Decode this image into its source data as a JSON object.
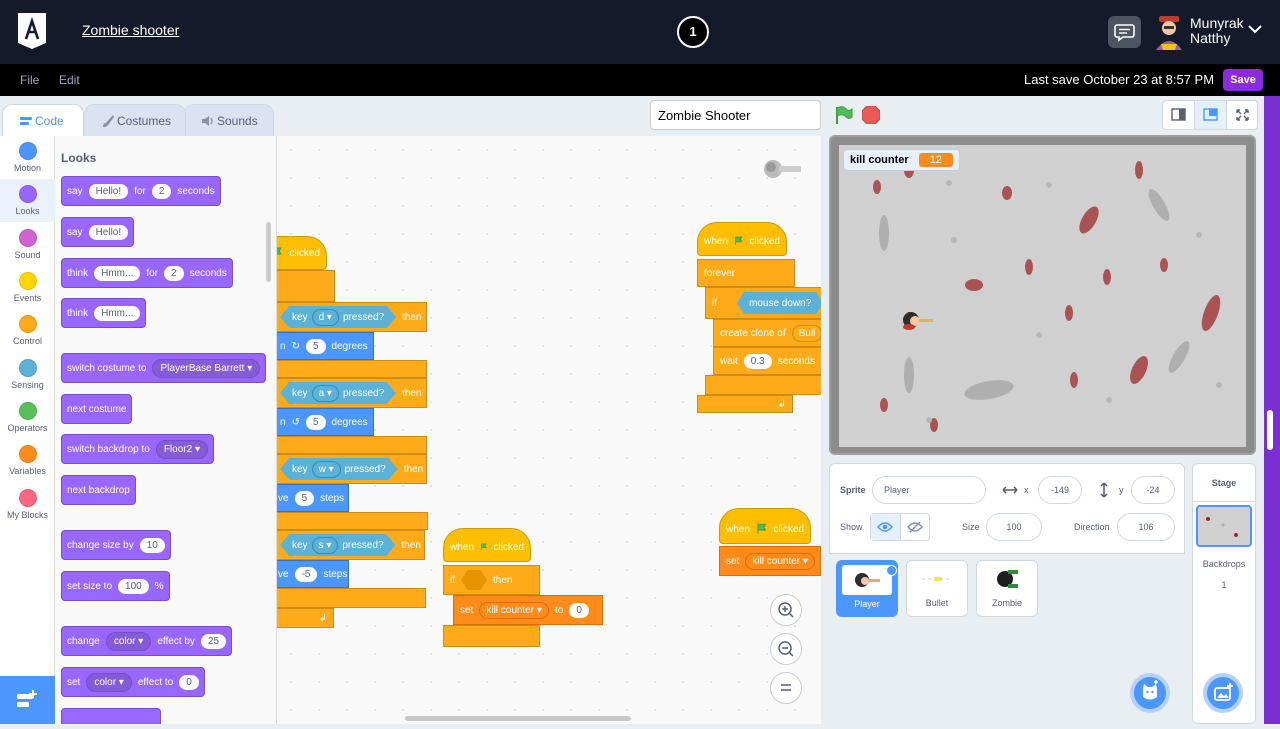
{
  "header": {
    "project_title": "Zombie shooter",
    "step_number": "1",
    "user_first": "Munyrak",
    "user_last": "Natthy"
  },
  "menubar": {
    "file": "File",
    "edit": "Edit",
    "last_save": "Last save October 23 at 8:57 PM",
    "save": "Save"
  },
  "tabs": {
    "code": "Code",
    "costumes": "Costumes",
    "sounds": "Sounds"
  },
  "categories": [
    {
      "label": "Motion",
      "color": "#4c97ff"
    },
    {
      "label": "Looks",
      "color": "#9966ff"
    },
    {
      "label": "Sound",
      "color": "#cf63cf"
    },
    {
      "label": "Events",
      "color": "#ffd500"
    },
    {
      "label": "Control",
      "color": "#ffab19"
    },
    {
      "label": "Sensing",
      "color": "#5cb1d6"
    },
    {
      "label": "Operators",
      "color": "#59c059"
    },
    {
      "label": "Variables",
      "color": "#ff8c1a"
    },
    {
      "label": "My Blocks",
      "color": "#ff6680"
    }
  ],
  "palette": {
    "title": "Looks",
    "say_for": {
      "say": "say",
      "msg": "Hello!",
      "for": "for",
      "secs": "2",
      "seconds": "seconds"
    },
    "say": {
      "say": "say",
      "msg": "Hello!"
    },
    "think_for": {
      "think": "think",
      "msg": "Hmm...",
      "for": "for",
      "secs": "2",
      "seconds": "seconds"
    },
    "think": {
      "think": "think",
      "msg": "Hmm..."
    },
    "switch_costume": {
      "label": "switch costume to",
      "value": "PlayerBase Barrett"
    },
    "next_costume": "next costume",
    "switch_backdrop": {
      "label": "switch backdrop to",
      "value": "Floor2"
    },
    "next_backdrop": "next backdrop",
    "change_size": {
      "label": "change size by",
      "value": "10"
    },
    "set_size": {
      "label": "set size to",
      "value": "100",
      "unit": "%"
    },
    "change_effect": {
      "label": "change",
      "effect": "color",
      "by": "effect by",
      "value": "25"
    },
    "set_effect": {
      "label": "set",
      "effect": "color",
      "to": "effect to",
      "value": "0"
    }
  },
  "script1": {
    "clicked": "clicked",
    "key": "key",
    "pressed": "pressed?",
    "then": "then",
    "degrees": "degrees",
    "steps": "steps",
    "k1": "d",
    "v1": "5",
    "k2": "a",
    "v2": "5",
    "k3": "w",
    "v3": "5",
    "k4": "s",
    "v4": "-5",
    "turn_n": "n",
    "move_frag": "ve"
  },
  "script2": {
    "when": "when",
    "clicked": "clicked",
    "forever": "forever",
    "if": "if",
    "mouse_down": "mouse down?",
    "create_clone": "create clone of",
    "clone_target": "Bull",
    "wait": "wait",
    "wait_value": "0.3",
    "seconds": "seconds"
  },
  "script3": {
    "when": "when",
    "clicked": "clicked",
    "if": "if",
    "then": "then",
    "set": "set",
    "var": "kill counter",
    "to": "to",
    "value": "0"
  },
  "script4": {
    "when": "when",
    "clicked": "clicked",
    "set": "set",
    "var": "kill counter"
  },
  "project_name_value": "Zombie Shooter",
  "stage": {
    "monitor_label": "kill counter",
    "monitor_value": "12"
  },
  "sprite_info": {
    "sprite_label": "Sprite",
    "sprite_name": "Player",
    "x_label": "x",
    "x_value": "-149",
    "y_label": "y",
    "y_value": "-24",
    "show_label": "Show",
    "size_label": "Size",
    "size_value": "100",
    "direction_label": "Direction",
    "direction_value": "106"
  },
  "sprites": [
    {
      "name": "Player"
    },
    {
      "name": "Bullet"
    },
    {
      "name": "Zombie"
    }
  ],
  "stage_pane": {
    "title": "Stage",
    "backdrops_label": "Backdrops",
    "backdrops_count": "1"
  }
}
